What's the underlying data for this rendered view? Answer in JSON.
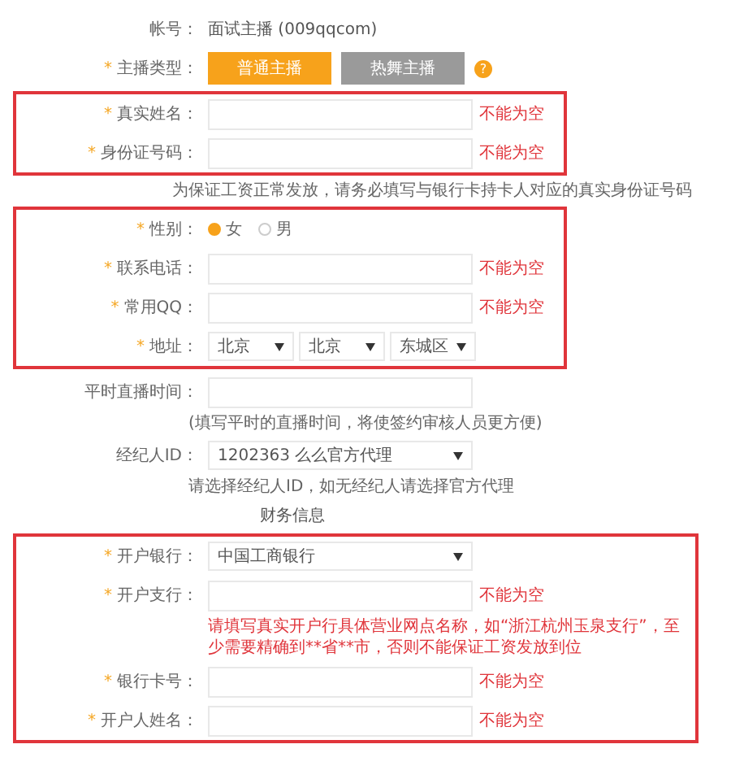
{
  "groups": [
    {
      "highlighted": false,
      "rows": [
        {
          "kind": "text",
          "label": "帐号：",
          "value": "面试主播 (009qqcom)"
        },
        {
          "kind": "buttons",
          "mark": "*",
          "label": "主播类型：",
          "options": [
            {
              "label": "普通主播",
              "selected": true
            },
            {
              "label": "热舞主播",
              "selected": false
            }
          ],
          "help": "?"
        }
      ]
    },
    {
      "highlighted": true,
      "rows": [
        {
          "kind": "input",
          "mark": "*",
          "label": "真实姓名：",
          "error": "不能为空"
        },
        {
          "kind": "input",
          "mark": "*",
          "label": "身份证号码：",
          "error": "不能为空"
        }
      ]
    },
    {
      "highlighted": false,
      "rows": [
        {
          "kind": "hint",
          "text": "为保证工资正常发放，请务必填写与银行卡持卡人对应的真实身份证号码"
        }
      ]
    },
    {
      "highlighted": true,
      "rows": [
        {
          "kind": "radio",
          "mark": "*",
          "label": "性别：",
          "options": [
            {
              "label": "女",
              "selected": true
            },
            {
              "label": "男",
              "selected": false
            }
          ]
        },
        {
          "kind": "input",
          "mark": "*",
          "label": "联系电话：",
          "error": "不能为空"
        },
        {
          "kind": "input",
          "mark": "*",
          "label": "常用QQ：",
          "error": "不能为空"
        },
        {
          "kind": "selects",
          "mark": "*",
          "label": "地址：",
          "values": [
            "北京",
            "北京",
            "东城区"
          ]
        }
      ]
    },
    {
      "highlighted": false,
      "rows": [
        {
          "kind": "input",
          "label": "平时直播时间："
        },
        {
          "kind": "hint",
          "text": "(填写平时的直播时间，将使签约审核人员更方便)"
        },
        {
          "kind": "select",
          "label": "经纪人ID：",
          "value": "1202363 么么官方代理"
        },
        {
          "kind": "hint",
          "text": "请选择经纪人ID，如无经纪人请选择官方代理"
        },
        {
          "kind": "section",
          "text": "财务信息"
        }
      ]
    },
    {
      "highlighted": true,
      "rows": [
        {
          "kind": "select",
          "mark": "*",
          "label": "开户银行：",
          "value": "中国工商银行"
        },
        {
          "kind": "input",
          "mark": "*",
          "label": "开户支行：",
          "error": "不能为空"
        },
        {
          "kind": "note",
          "text": "请填写真实开户行具体营业网点名称，如“浙江杭州玉泉支行”，至少需要精确到**省**市，否则不能保证工资发放到位"
        },
        {
          "kind": "input",
          "mark": "*",
          "label": "银行卡号：",
          "error": "不能为空"
        },
        {
          "kind": "input",
          "mark": "*",
          "label": "开户人姓名：",
          "error": "不能为空"
        }
      ]
    }
  ]
}
